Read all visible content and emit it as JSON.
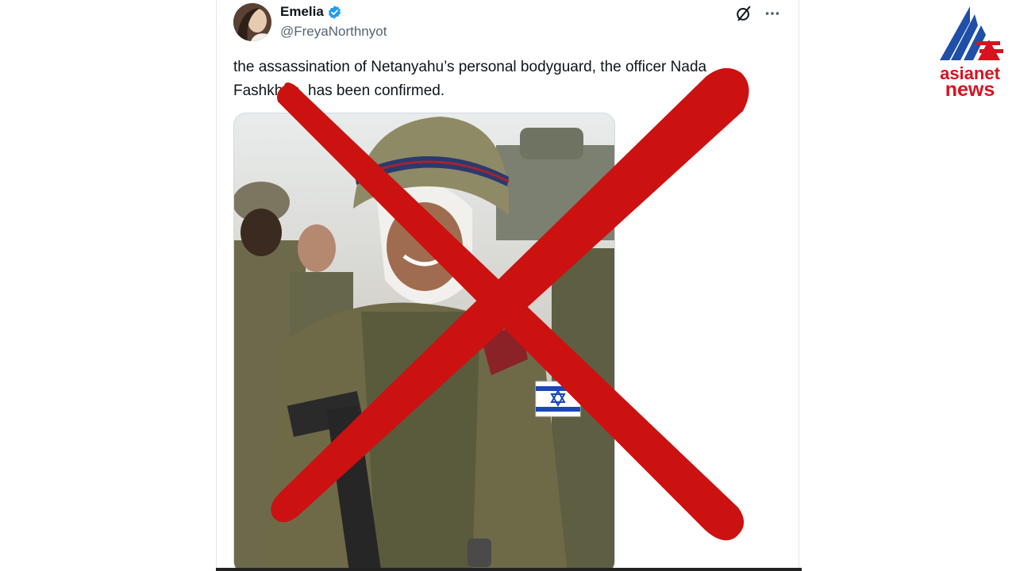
{
  "tweet": {
    "author_name": "Emelia",
    "author_handle": "@FreyaNorthnyot",
    "verified": true,
    "text": "the assassination of Netanyahu’s personal bodyguard, the officer Nada Fashkhan, has been confirmed.",
    "actions": {
      "grok_icon": "grok-icon",
      "more_icon": "more-icon"
    }
  },
  "media": {
    "description_icon": "photo",
    "flag_badge": "israel-flag"
  },
  "overlay": {
    "mark": "red-x-fact-check",
    "color": "#cc1111"
  },
  "brand": {
    "logo_line1": "asianet",
    "logo_line2": "news",
    "color_red": "#d8121f",
    "color_blue": "#1f4fa6"
  }
}
